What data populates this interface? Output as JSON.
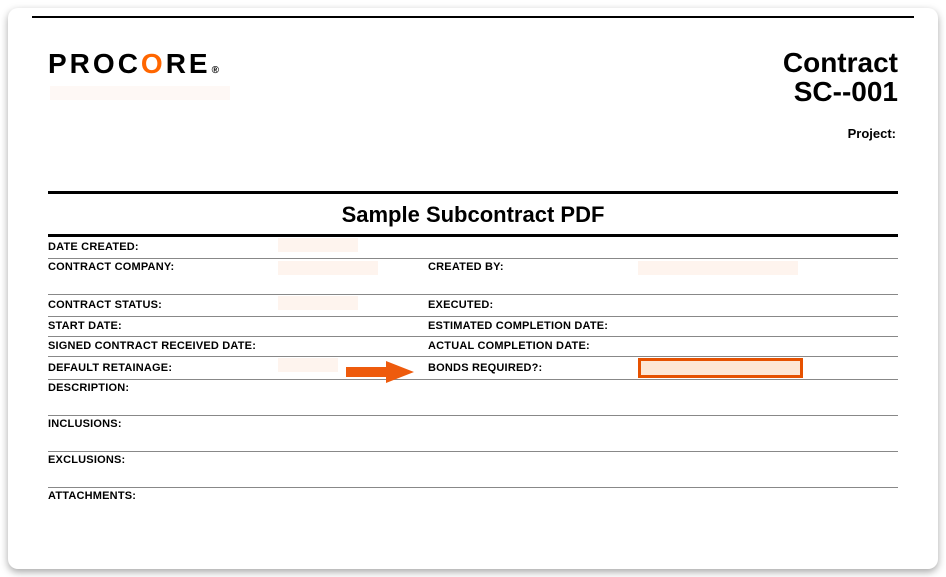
{
  "logo": {
    "pre": "PR",
    "accent": "O",
    "mid": "C",
    "accent2": "O",
    "post": "RE",
    "reg": "®"
  },
  "header": {
    "title_line1": "Contract",
    "title_line2": "SC--001",
    "project_label": "Project:"
  },
  "document": {
    "title": "Sample Subcontract PDF"
  },
  "fields": {
    "date_created": "DATE CREATED:",
    "contract_company": "CONTRACT COMPANY:",
    "created_by": "CREATED BY:",
    "contract_status": "CONTRACT STATUS:",
    "executed": "EXECUTED:",
    "start_date": "START DATE:",
    "estimated_completion": "ESTIMATED COMPLETION DATE:",
    "signed_received": "SIGNED CONTRACT RECEIVED DATE:",
    "actual_completion": "ACTUAL COMPLETION DATE:",
    "default_retainage": "DEFAULT RETAINAGE:",
    "bonds_required": "BONDS REQUIRED?:",
    "description": "DESCRIPTION:",
    "inclusions": "INCLUSIONS:",
    "exclusions": "EXCLUSIONS:",
    "attachments": "ATTACHMENTS:"
  },
  "annotation": {
    "arrow_color": "#ee5b0d",
    "highlight_border": "#e65100",
    "highlight_fill": "#fde6d4"
  }
}
